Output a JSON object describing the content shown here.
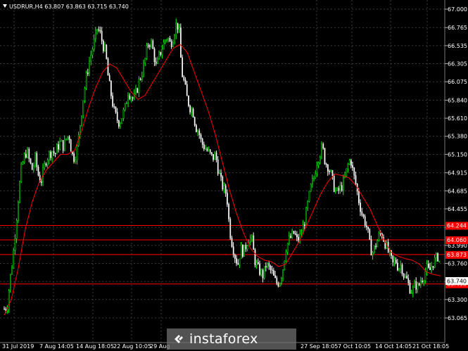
{
  "header": {
    "text": "USDRUR,H4  63.807 63.863 63.715 63.740"
  },
  "price_scale": [
    "67.000",
    "66.765",
    "66.535",
    "66.305",
    "66.075",
    "65.840",
    "65.610",
    "65.380",
    "65.150",
    "64.915",
    "64.685",
    "64.455",
    "64.220",
    "63.990",
    "63.760",
    "63.530",
    "63.300",
    "63.065"
  ],
  "time_scale": [
    "31 Jul 2019",
    "7 Aug 14:05",
    "14 Aug 18:05",
    "22 Aug 10:05",
    "29 Aug",
    "27 Sep 18:05",
    "7 Oct 10:05",
    "14 Oct 14:05",
    "21 Oct 18:05"
  ],
  "level_tags": [
    "64.244",
    "64.060",
    "63.873",
    "63.498"
  ],
  "current_price": "63.740",
  "logo": {
    "text": "instaforex",
    "icon": "instaforex-logo-icon"
  },
  "colors": {
    "background": "#000000",
    "bull": "#00ff00",
    "bear": "#ffffff",
    "ma": "#ff0000",
    "grid": "#3a3a3a",
    "levels": "#ff0000"
  },
  "chart_data": {
    "type": "candlestick",
    "symbol": "USDRUR",
    "timeframe": "H4",
    "ohlc_last": {
      "open": 63.807,
      "high": 63.863,
      "low": 63.715,
      "close": 63.74
    },
    "ylim": [
      63.065,
      67.0
    ],
    "horizontal_levels": [
      64.244,
      64.06,
      63.873,
      63.498
    ],
    "close_path": [
      [
        0,
        63.18
      ],
      [
        4,
        63.2
      ],
      [
        8,
        63.55
      ],
      [
        12,
        63.8
      ],
      [
        16,
        64.2
      ],
      [
        20,
        64.6
      ],
      [
        24,
        64.95
      ],
      [
        28,
        65.1
      ],
      [
        32,
        65.2
      ],
      [
        36,
        65.05
      ],
      [
        40,
        64.95
      ],
      [
        44,
        65.1
      ],
      [
        48,
        64.9
      ],
      [
        52,
        64.8
      ],
      [
        56,
        64.95
      ],
      [
        60,
        65.1
      ],
      [
        64,
        65.15
      ],
      [
        68,
        65.2
      ],
      [
        72,
        65.15
      ],
      [
        76,
        65.25
      ],
      [
        80,
        65.3
      ],
      [
        84,
        65.25
      ],
      [
        88,
        65.35
      ],
      [
        92,
        65.4
      ],
      [
        96,
        65.15
      ],
      [
        100,
        65.1
      ],
      [
        104,
        65.25
      ],
      [
        108,
        65.55
      ],
      [
        112,
        65.85
      ],
      [
        116,
        66.1
      ],
      [
        120,
        66.3
      ],
      [
        124,
        66.45
      ],
      [
        128,
        66.6
      ],
      [
        132,
        66.75
      ],
      [
        136,
        66.7
      ],
      [
        140,
        66.55
      ],
      [
        144,
        66.45
      ],
      [
        148,
        66.1
      ],
      [
        152,
        65.9
      ],
      [
        156,
        65.7
      ],
      [
        160,
        65.6
      ],
      [
        164,
        65.55
      ],
      [
        168,
        65.65
      ],
      [
        172,
        65.75
      ],
      [
        176,
        65.95
      ],
      [
        180,
        65.9
      ],
      [
        184,
        65.85
      ],
      [
        188,
        65.95
      ],
      [
        192,
        66.1
      ],
      [
        196,
        66.2
      ],
      [
        200,
        66.35
      ],
      [
        204,
        66.55
      ],
      [
        208,
        66.6
      ],
      [
        212,
        66.45
      ],
      [
        216,
        66.25
      ],
      [
        220,
        66.4
      ],
      [
        224,
        66.5
      ],
      [
        228,
        66.6
      ],
      [
        232,
        66.65
      ],
      [
        236,
        66.55
      ],
      [
        240,
        66.65
      ],
      [
        244,
        66.8
      ],
      [
        248,
        66.78
      ],
      [
        252,
        66.2
      ],
      [
        256,
        66.05
      ],
      [
        260,
        65.85
      ],
      [
        264,
        65.75
      ],
      [
        268,
        65.7
      ],
      [
        272,
        65.5
      ],
      [
        276,
        65.45
      ],
      [
        280,
        65.3
      ],
      [
        284,
        65.25
      ],
      [
        288,
        65.2
      ],
      [
        292,
        65.15
      ],
      [
        296,
        65.1
      ],
      [
        300,
        65.15
      ],
      [
        304,
        64.95
      ],
      [
        308,
        64.8
      ],
      [
        312,
        64.7
      ],
      [
        316,
        64.65
      ],
      [
        320,
        64.2
      ],
      [
        324,
        64.0
      ],
      [
        328,
        63.85
      ],
      [
        332,
        63.75
      ],
      [
        336,
        63.95
      ],
      [
        340,
        63.9
      ],
      [
        344,
        64.0
      ],
      [
        348,
        64.1
      ],
      [
        352,
        64.05
      ],
      [
        356,
        63.8
      ],
      [
        360,
        63.7
      ],
      [
        364,
        63.65
      ],
      [
        368,
        63.6
      ],
      [
        372,
        63.75
      ],
      [
        376,
        63.7
      ],
      [
        380,
        63.65
      ],
      [
        384,
        63.55
      ],
      [
        388,
        63.5
      ],
      [
        392,
        63.55
      ],
      [
        396,
        63.7
      ],
      [
        400,
        63.95
      ],
      [
        404,
        64.05
      ],
      [
        408,
        64.1
      ],
      [
        412,
        64.15
      ],
      [
        416,
        64.05
      ],
      [
        420,
        64.1
      ],
      [
        424,
        64.2
      ],
      [
        428,
        64.35
      ],
      [
        432,
        64.55
      ],
      [
        436,
        64.75
      ],
      [
        440,
        64.85
      ],
      [
        444,
        65.05
      ],
      [
        448,
        65.15
      ],
      [
        452,
        65.25
      ],
      [
        456,
        65.05
      ],
      [
        460,
        65.0
      ],
      [
        464,
        64.9
      ],
      [
        468,
        64.75
      ],
      [
        472,
        64.65
      ],
      [
        476,
        64.7
      ],
      [
        480,
        64.75
      ],
      [
        484,
        64.85
      ],
      [
        488,
        65.0
      ],
      [
        492,
        65.1
      ],
      [
        496,
        64.9
      ],
      [
        500,
        64.75
      ],
      [
        504,
        64.55
      ],
      [
        508,
        64.4
      ],
      [
        512,
        64.3
      ],
      [
        516,
        64.2
      ],
      [
        520,
        63.95
      ],
      [
        524,
        63.9
      ],
      [
        528,
        64.0
      ],
      [
        532,
        64.1
      ],
      [
        536,
        64.15
      ],
      [
        540,
        64.05
      ],
      [
        544,
        63.95
      ],
      [
        548,
        63.85
      ],
      [
        552,
        63.75
      ],
      [
        556,
        63.8
      ],
      [
        560,
        63.7
      ],
      [
        564,
        63.75
      ],
      [
        568,
        63.6
      ],
      [
        572,
        63.55
      ],
      [
        576,
        63.45
      ],
      [
        580,
        63.4
      ],
      [
        584,
        63.5
      ],
      [
        588,
        63.45
      ],
      [
        592,
        63.55
      ],
      [
        596,
        63.6
      ],
      [
        600,
        63.7
      ],
      [
        604,
        63.65
      ],
      [
        608,
        63.75
      ],
      [
        612,
        63.8
      ],
      [
        616,
        63.85
      ],
      [
        620,
        63.74
      ]
    ],
    "ma_path": [
      [
        0,
        63.1
      ],
      [
        10,
        63.3
      ],
      [
        20,
        63.7
      ],
      [
        30,
        64.2
      ],
      [
        40,
        64.55
      ],
      [
        50,
        64.8
      ],
      [
        60,
        64.95
      ],
      [
        70,
        65.05
      ],
      [
        80,
        65.15
      ],
      [
        90,
        65.15
      ],
      [
        100,
        65.2
      ],
      [
        110,
        65.45
      ],
      [
        120,
        65.75
      ],
      [
        130,
        66.0
      ],
      [
        140,
        66.2
      ],
      [
        150,
        66.3
      ],
      [
        160,
        66.25
      ],
      [
        170,
        66.1
      ],
      [
        180,
        65.95
      ],
      [
        190,
        65.85
      ],
      [
        200,
        65.9
      ],
      [
        210,
        66.05
      ],
      [
        220,
        66.2
      ],
      [
        230,
        66.35
      ],
      [
        240,
        66.5
      ],
      [
        250,
        66.55
      ],
      [
        260,
        66.45
      ],
      [
        270,
        66.2
      ],
      [
        280,
        65.95
      ],
      [
        290,
        65.7
      ],
      [
        300,
        65.4
      ],
      [
        310,
        65.05
      ],
      [
        320,
        64.7
      ],
      [
        330,
        64.4
      ],
      [
        340,
        64.15
      ],
      [
        350,
        63.95
      ],
      [
        360,
        63.85
      ],
      [
        370,
        63.8
      ],
      [
        380,
        63.78
      ],
      [
        390,
        63.72
      ],
      [
        400,
        63.75
      ],
      [
        410,
        63.9
      ],
      [
        420,
        64.05
      ],
      [
        430,
        64.25
      ],
      [
        440,
        64.45
      ],
      [
        450,
        64.65
      ],
      [
        460,
        64.8
      ],
      [
        470,
        64.9
      ],
      [
        480,
        64.88
      ],
      [
        490,
        64.85
      ],
      [
        500,
        64.75
      ],
      [
        510,
        64.6
      ],
      [
        520,
        64.45
      ],
      [
        530,
        64.25
      ],
      [
        540,
        64.05
      ],
      [
        550,
        63.9
      ],
      [
        560,
        63.85
      ],
      [
        570,
        63.82
      ],
      [
        580,
        63.8
      ],
      [
        590,
        63.75
      ],
      [
        600,
        63.65
      ],
      [
        610,
        63.62
      ],
      [
        620,
        63.6
      ]
    ]
  }
}
